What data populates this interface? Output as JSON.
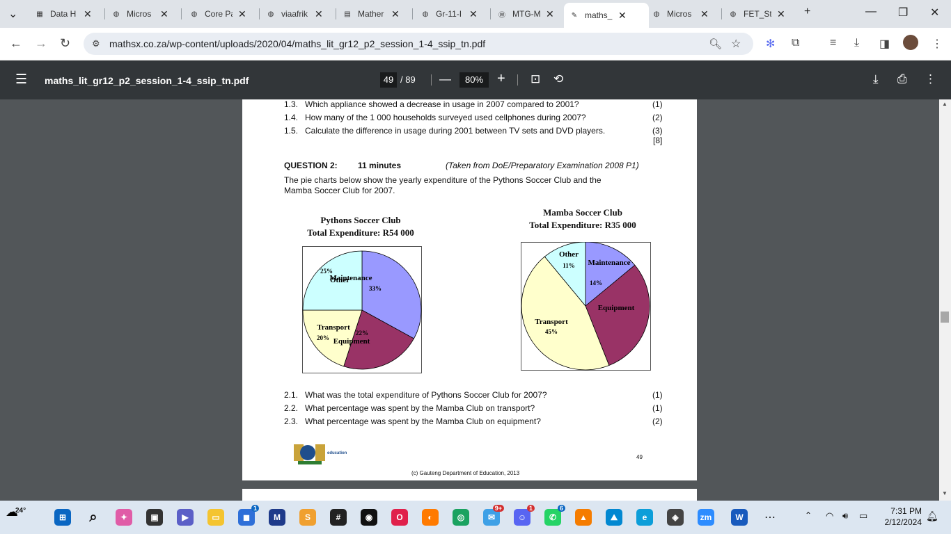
{
  "tabs": [
    {
      "label": "Data H",
      "icon": "data-icon"
    },
    {
      "label": "Micros",
      "icon": "globe-icon"
    },
    {
      "label": "Core Pa",
      "icon": "globe-icon"
    },
    {
      "label": "viaafrik",
      "icon": "globe-icon"
    },
    {
      "label": "Mather",
      "icon": "doc-icon"
    },
    {
      "label": "Gr-11-I",
      "icon": "globe-icon"
    },
    {
      "label": "MTG-M",
      "icon": "wordpress-icon"
    },
    {
      "label": "maths_",
      "icon": "pdf-icon"
    },
    {
      "label": "Micros",
      "icon": "globe-icon"
    },
    {
      "label": "FET_Stu",
      "icon": "globe-icon"
    }
  ],
  "address": {
    "url": "mathsx.co.za/wp-content/uploads/2020/04/maths_lit_gr12_p2_session_1-4_ssip_tn.pdf"
  },
  "pdf": {
    "filename": "maths_lit_gr12_p2_session_1-4_ssip_tn.pdf",
    "page": "49",
    "total": "/ 89",
    "zoom": "80%"
  },
  "doc": {
    "q1": [
      {
        "num": "1.3.",
        "text": "Which appliance showed a decrease in usage in 2007 compared to 2001?",
        "mark": "(1)"
      },
      {
        "num": "1.4.",
        "text": "How many of the 1 000 households surveyed used cellphones during 2007?",
        "mark": "(2)"
      },
      {
        "num": "1.5.",
        "text": "Calculate the difference in usage during 2001 between TV sets and DVD players.",
        "mark": "(3)"
      }
    ],
    "q1_total": "[8]",
    "q2_title": "QUESTION 2:",
    "q2_time": "11 minutes",
    "q2_source": "(Taken from DoE/Preparatory Examination 2008 P1)",
    "q2_intro1": "The pie charts below show the yearly expenditure of the Pythons Soccer Club and the",
    "q2_intro2": "Mamba Soccer Club for 2007.",
    "q2": [
      {
        "num": "2.1.",
        "text": "What was the total expenditure of Pythons Soccer Club for 2007?",
        "mark": "(1)"
      },
      {
        "num": "2.2.",
        "text": "What percentage was spent by the Mamba Club on transport?",
        "mark": "(1)"
      },
      {
        "num": "2.3.",
        "text": "What percentage was spent by the Mamba Club on equipment?",
        "mark": "(2)"
      }
    ],
    "page_number": "49",
    "logo_text": "education",
    "footer": "(c) Gauteng Department of Education, 2013"
  },
  "chart_data": [
    {
      "type": "pie",
      "title": "Pythons Soccer Club",
      "subtitle": "Total Expenditure: R54 000",
      "categories": [
        "Maintenance",
        "Equipment",
        "Transport",
        "Other"
      ],
      "values": [
        33,
        22,
        20,
        25
      ],
      "value_labels": [
        "33%",
        "22%",
        "20%",
        "25%"
      ],
      "colors": [
        "#9999ff",
        "#993366",
        "#ffffcc",
        "#ccffff"
      ]
    },
    {
      "type": "pie",
      "title": "Mamba Soccer Club",
      "subtitle": "Total Expenditure: R35 000",
      "categories": [
        "Maintenance",
        "Equipment",
        "Transport",
        "Other"
      ],
      "values": [
        14,
        30,
        45,
        11
      ],
      "value_labels": [
        "14%",
        "",
        "45%",
        "11%"
      ],
      "colors": [
        "#9999ff",
        "#993366",
        "#ffffcc",
        "#ccffff"
      ]
    }
  ],
  "taskbar": {
    "weather": "24°",
    "time": "7:31 PM",
    "date": "2/12/2024",
    "badges": {
      "notif_a": "1",
      "notif_b": "9+",
      "notif_c": "1",
      "notif_d": "6"
    }
  }
}
